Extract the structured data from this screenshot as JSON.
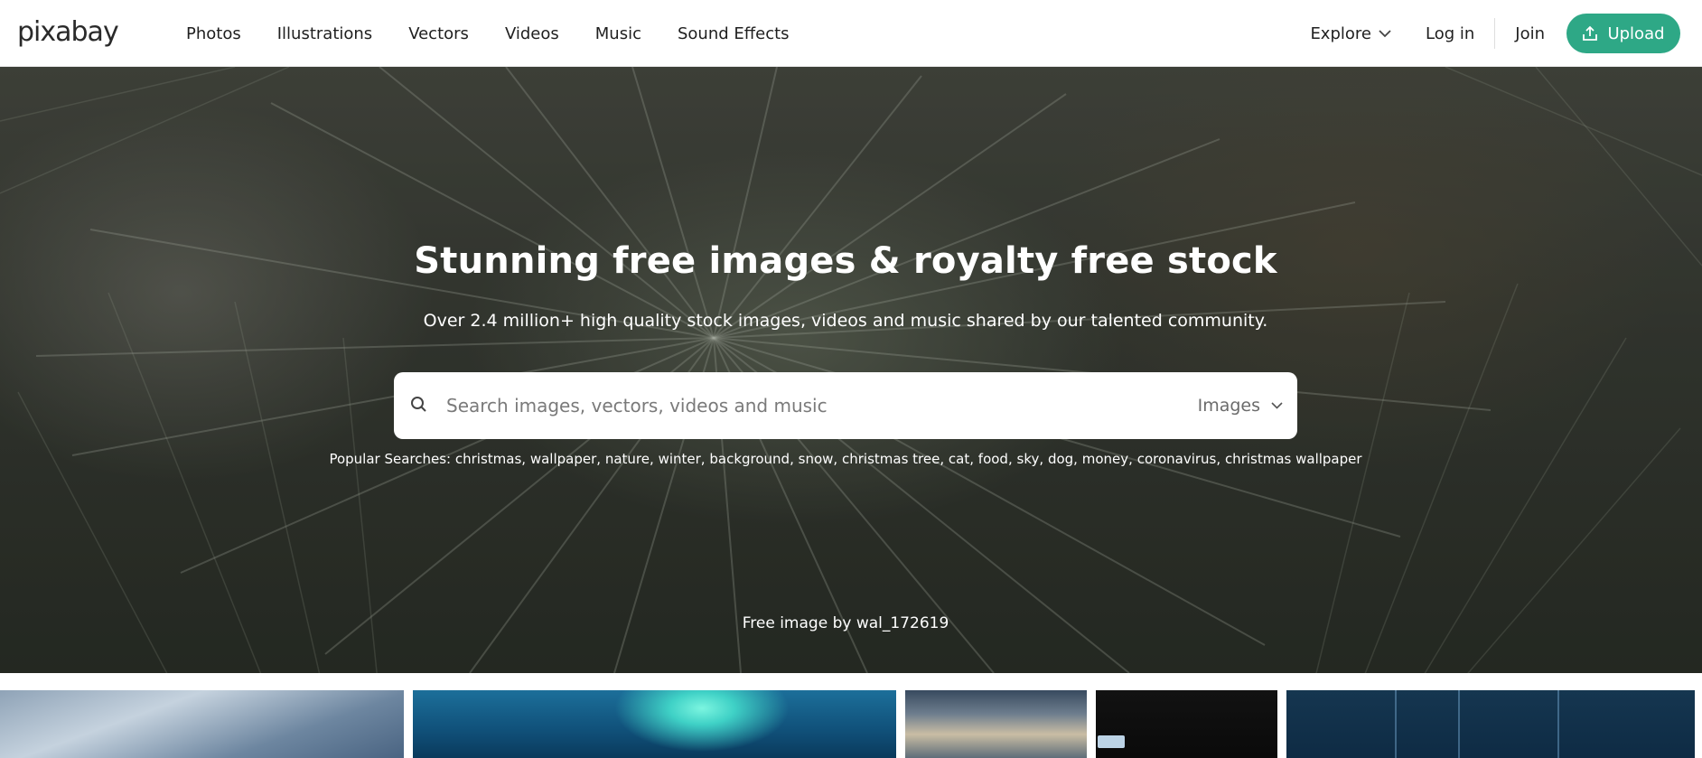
{
  "header": {
    "logo": "pixabay",
    "nav": [
      "Photos",
      "Illustrations",
      "Vectors",
      "Videos",
      "Music",
      "Sound Effects"
    ],
    "explore_label": "Explore",
    "login_label": "Log in",
    "join_label": "Join",
    "upload_label": "Upload"
  },
  "hero": {
    "title": "Stunning free images & royalty free stock",
    "subtitle": "Over 2.4 million+ high quality stock images, videos and music shared by our talented community.",
    "search": {
      "placeholder": "Search images, vectors, videos and music",
      "type_label": "Images"
    },
    "popular_label": "Popular Searches:",
    "popular_terms": [
      "christmas",
      "wallpaper",
      "nature",
      "winter",
      "background",
      "snow",
      "christmas tree",
      "cat",
      "food",
      "sky",
      "dog",
      "money",
      "coronavirus",
      "christmas wallpaper"
    ],
    "credit": "Free image by wal_172619"
  },
  "colors": {
    "accent": "#2ea886",
    "text": "#1f1f1f"
  },
  "icons": [
    "chevron-down-icon",
    "upload-icon",
    "search-icon"
  ]
}
